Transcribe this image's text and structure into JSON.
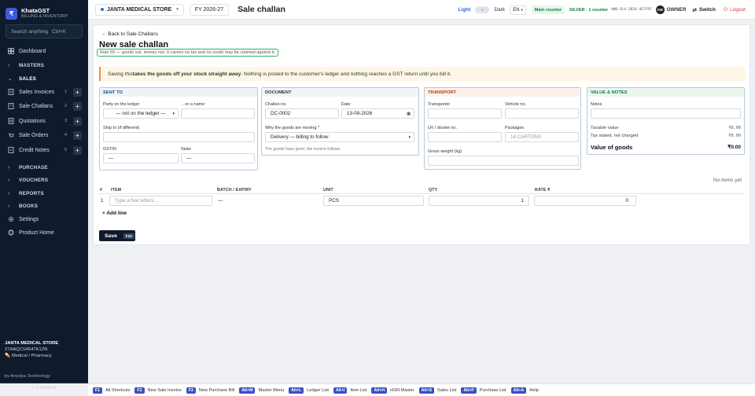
{
  "brand": {
    "name": "KhataGST",
    "sub": "BILLING & INVENTORY",
    "logo_letter": "₹"
  },
  "search": {
    "placeholder": "Search anything",
    "kbd": "Ctrl+K"
  },
  "nav": {
    "dashboard": "Dashboard",
    "masters": "MASTERS",
    "sales": "SALES",
    "items": [
      {
        "label": "Sales Invoices",
        "count": "1"
      },
      {
        "label": "Sale Challans",
        "count": "2"
      },
      {
        "label": "Quotations",
        "count": "3"
      },
      {
        "label": "Sale Orders",
        "count": "4"
      },
      {
        "label": "Credit Notes",
        "count": "5"
      }
    ],
    "purchase": "PURCHASE",
    "vouchers": "VOUCHERS",
    "reports": "REPORTS",
    "books": "BOOKS",
    "settings": "Settings",
    "product_home": "Product Home"
  },
  "sidebar_footer": {
    "shop": "JANTA MEDICAL STORE",
    "gstin": "27AAQCS4547K1ZN",
    "type": "Medical / Pharmacy",
    "by": "by Anedya Technology",
    "collapse": "« Collapse"
  },
  "topbar": {
    "shop": "JANTA MEDICAL STORE",
    "fy": "FY 2026-27",
    "page_title": "Sale challan",
    "light": "Light",
    "dark": "Dark",
    "lang": "EN",
    "counter": "Main counter",
    "plan": "SILVER · 1 counter",
    "plan_id": "ANO-SLV-2026-4E7F97",
    "owner_badge": "OW",
    "owner": "OWNER",
    "switch": "Switch",
    "logout": "Logout"
  },
  "form": {
    "back": "← Back to Sale Challans",
    "title": "New sale challan",
    "rule": "Rule 55 — goods out, money not. It carries no tax and no credit may be claimed against it.",
    "banner_pre": "Saving this ",
    "banner_bold": "takes the goods off your stock straight away",
    "banner_post": ". Nothing is posted to the customer's ledger and nothing reaches a GST return until you bill it.",
    "sent_to": {
      "head": "SENT TO",
      "party_label": "Party on the ledger",
      "party_value": "— not on the ledger —",
      "name_label": "…or a name",
      "ship_label": "Ship to (if different)",
      "gstin_label": "GSTIN",
      "gstin_value": "—",
      "state_label": "State",
      "state_value": "—"
    },
    "document": {
      "head": "DOCUMENT",
      "challan_label": "Challan no.",
      "challan_value": "DC-0002",
      "date_label": "Date",
      "date_value": "13-09-2026",
      "why_label": "Why the goods are moving *",
      "why_value": "Delivery — billing to follow",
      "why_hint": "The goods have gone; the invoice follows."
    },
    "transport": {
      "head": "TRANSPORT",
      "transporter_label": "Transporter",
      "vehicle_label": "Vehicle no.",
      "lr_label": "LR / docket no.",
      "packages_label": "Packages",
      "packages_placeholder": "14 CARTONS",
      "weight_label": "Gross weight (kg)"
    },
    "value": {
      "head": "VALUE & NOTES",
      "notes_label": "Notes",
      "taxable_label": "Taxable value",
      "taxable_value": "₹0.00",
      "tax_label": "Tax stated, not charged",
      "tax_value": "₹0.00",
      "goods_label": "Value of goods",
      "goods_value": "₹0.00"
    },
    "no_items": "No items yet",
    "table": {
      "headers": [
        "#",
        "ITEM",
        "BATCH / EXPIRY",
        "UNIT",
        "QTY",
        "RATE ₹"
      ],
      "row": {
        "num": "1",
        "item_placeholder": "Type a few letters...",
        "batch": "—",
        "unit": "PCS",
        "qty": "1",
        "rate": "0"
      }
    },
    "add_line": "+ Add line",
    "save": "Save",
    "save_kbd": "F10"
  },
  "shortcuts": [
    {
      "key": "F1",
      "label": "All Shortcuts"
    },
    {
      "key": "F2",
      "label": "New Sale Invoice"
    },
    {
      "key": "F3",
      "label": "New Purchase Bill"
    },
    {
      "key": "Alt+M",
      "label": "Master Menu"
    },
    {
      "key": "Alt+L",
      "label": "Ledger List"
    },
    {
      "key": "Alt+I",
      "label": "Item List"
    },
    {
      "key": "Alt+H",
      "label": "HSN Master"
    },
    {
      "key": "Alt+S",
      "label": "Sales List"
    },
    {
      "key": "Alt+P",
      "label": "Purchase List"
    },
    {
      "key": "Alt+A",
      "label": "Help"
    }
  ],
  "colors": {
    "sidebar": "#0f1b2d",
    "accent": "#3b4fc4",
    "highlight": "#2fb05a",
    "banner": "#fff7e6",
    "transport_head": "#b23b1e",
    "value_head": "#157a3c",
    "sent_head": "#1f4f8c"
  }
}
